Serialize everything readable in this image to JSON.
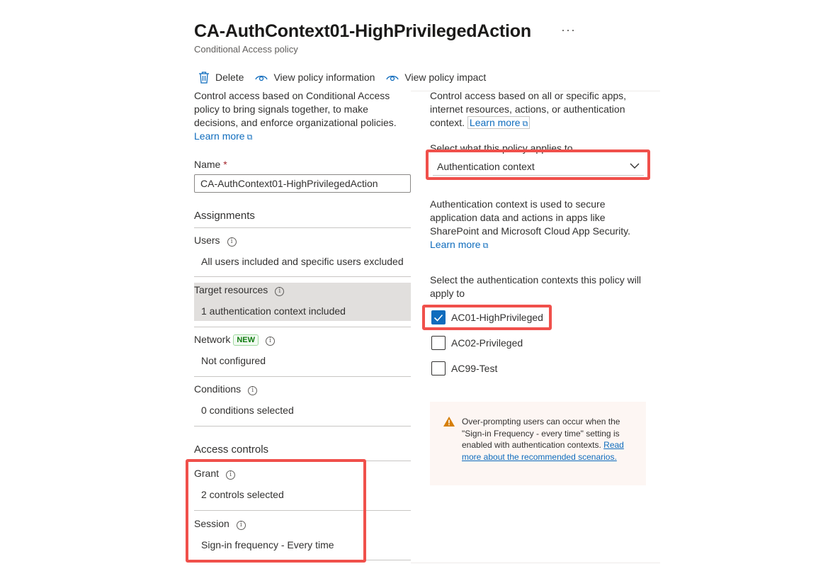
{
  "header": {
    "title": "CA-AuthContext01-HighPrivilegedAction",
    "more_label": "···",
    "subtitle": "Conditional Access policy"
  },
  "toolbar": {
    "delete_label": "Delete",
    "view_info_label": "View policy information",
    "view_impact_label": "View policy impact"
  },
  "left": {
    "intro": "Control access based on Conditional Access policy to bring signals together, to make decisions, and enforce organizational policies.",
    "learn_more": "Learn more",
    "name_label": "Name",
    "required_mark": "*",
    "name_value": "CA-AuthContext01-HighPrivilegedAction",
    "assignments_heading": "Assignments",
    "users_label": "Users",
    "users_value": "All users included and specific users excluded",
    "target_label": "Target resources",
    "target_value": "1 authentication context included",
    "network_label": "Network",
    "network_badge": "NEW",
    "network_value": "Not configured",
    "conditions_label": "Conditions",
    "conditions_value": "0 conditions selected",
    "access_heading": "Access controls",
    "grant_label": "Grant",
    "grant_value": "2 controls selected",
    "session_label": "Session",
    "session_value": "Sign-in frequency - Every time"
  },
  "right": {
    "intro_before": "Control access based on all or specific apps, internet resources, actions, or authentication context.",
    "learn_more": "Learn more",
    "applies_label": "Select what this policy applies to",
    "applies_value": "Authentication context",
    "auth_desc": "Authentication context is used to secure application data and actions in apps like SharePoint and Microsoft Cloud App Security.",
    "learn_more2": "Learn more",
    "select_label": "Select the authentication contexts this policy will apply to",
    "contexts": [
      {
        "label": "AC01-HighPrivileged",
        "checked": true
      },
      {
        "label": "AC02-Privileged",
        "checked": false
      },
      {
        "label": "AC99-Test",
        "checked": false
      }
    ],
    "warning_text": "Over-prompting users can occur when the \"Sign-in Frequency - every time\" setting is enabled with authentication contexts.",
    "warning_link": "Read more about the recommended scenarios."
  },
  "colors": {
    "link": "#0f6cbd",
    "highlight": "#f0504b",
    "warning_icon": "#d67f0a"
  }
}
